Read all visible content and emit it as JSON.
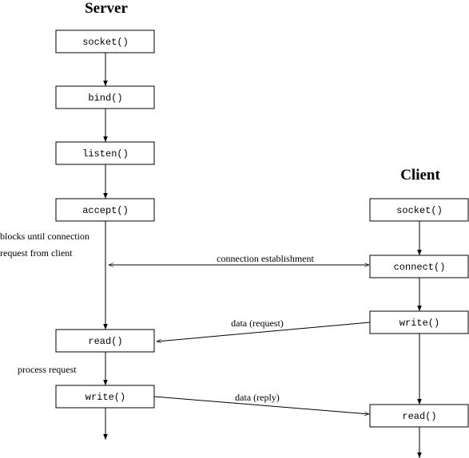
{
  "server": {
    "title": "Server",
    "calls": [
      "socket()",
      "bind()",
      "listen()",
      "accept()",
      "read()",
      "write()"
    ]
  },
  "client": {
    "title": "Client",
    "calls": [
      "socket()",
      "connect()",
      "write()",
      "read()"
    ]
  },
  "annotations": {
    "blocks_line1": "blocks until connection",
    "blocks_line2": "request from client",
    "connection": "connection establishment",
    "data_request": "data (request)",
    "process_request": "process request",
    "data_reply": "data (reply)"
  }
}
